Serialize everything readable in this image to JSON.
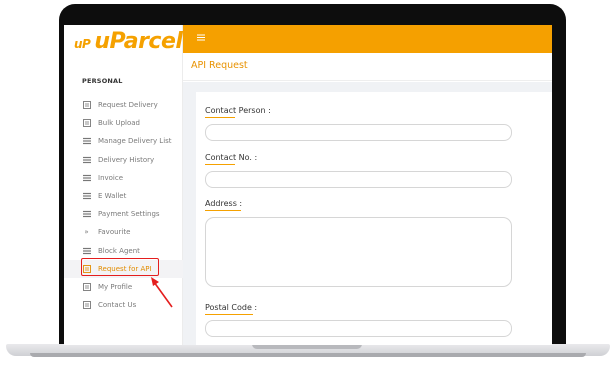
{
  "app": {
    "logo_small": "uP",
    "logo_big": "uParcel"
  },
  "sidebar": {
    "section_title": "PERSONAL",
    "items": [
      {
        "label": "Request Delivery",
        "icon": "doc-list-icon"
      },
      {
        "label": "Bulk Upload",
        "icon": "doc-list-icon"
      },
      {
        "label": "Manage Delivery List",
        "icon": "list-icon"
      },
      {
        "label": "Delivery History",
        "icon": "list-icon"
      },
      {
        "label": "Invoice",
        "icon": "list-icon"
      },
      {
        "label": "E Wallet",
        "icon": "list-icon"
      },
      {
        "label": "Payment Settings",
        "icon": "list-icon"
      },
      {
        "label": "Favourite",
        "icon": "double-chevron-icon"
      },
      {
        "label": "Block Agent",
        "icon": "list-icon"
      },
      {
        "label": "Request for API",
        "icon": "doc-list-icon",
        "active": true
      },
      {
        "label": "My Profile",
        "icon": "doc-list-icon"
      },
      {
        "label": "Contact Us",
        "icon": "doc-list-icon"
      }
    ]
  },
  "header": {
    "menu_icon": "hamburger-icon",
    "page_title": "API Request"
  },
  "form": {
    "contact_person_label": "Contact Person :",
    "contact_person_value": "",
    "contact_no_label": "Contact No. :",
    "contact_no_value": "",
    "address_label": "Address :",
    "address_value": "",
    "postal_code_label": "Postal Code :",
    "postal_code_value": ""
  },
  "colors": {
    "brand": "#f5a000",
    "accent_text": "#e89200",
    "annotation": "#e41e1e"
  }
}
